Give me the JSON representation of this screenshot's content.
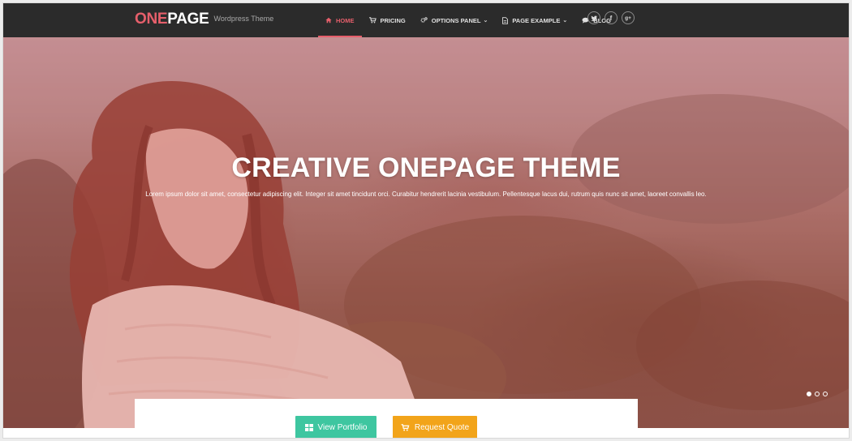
{
  "header": {
    "logo_one": "ONE",
    "logo_page": "PAGE",
    "tagline": "Wordpress Theme"
  },
  "nav": {
    "items": [
      {
        "label": "HOME",
        "icon": "home-icon",
        "active": true
      },
      {
        "label": "PRICING",
        "icon": "cart-icon",
        "active": false
      },
      {
        "label": "OPTIONS PANEL",
        "icon": "gears-icon",
        "active": false,
        "dropdown": true
      },
      {
        "label": "PAGE EXAMPLE",
        "icon": "file-icon",
        "active": false,
        "dropdown": true
      },
      {
        "label": "BLOG",
        "icon": "comment-icon",
        "active": false
      }
    ]
  },
  "social": {
    "twitter": "twitter-icon",
    "facebook": "facebook-icon",
    "google_plus": "google-plus-icon",
    "facebook_glyph": "f",
    "google_glyph": "g+"
  },
  "hero": {
    "title": "CREATIVE ONEPAGE THEME",
    "text": "Lorem ipsum dolor sit amet, consectetur adipiscing elit. Integer sit amet tincidunt orci. Curabitur hendrerit lacinia vestibulum. Pellentesque lacus dui, rutrum quis nunc sit amet, laoreet convallis leo.",
    "slides_total": 3,
    "active_slide": 1
  },
  "buttons": {
    "portfolio_label": "View Portfolio",
    "quote_label": "Request Quote"
  },
  "colors": {
    "accent": "#e65f6b",
    "header_bg": "#2b2b2b",
    "portfolio_btn": "#3ec6a0",
    "quote_btn": "#f2a41a"
  }
}
